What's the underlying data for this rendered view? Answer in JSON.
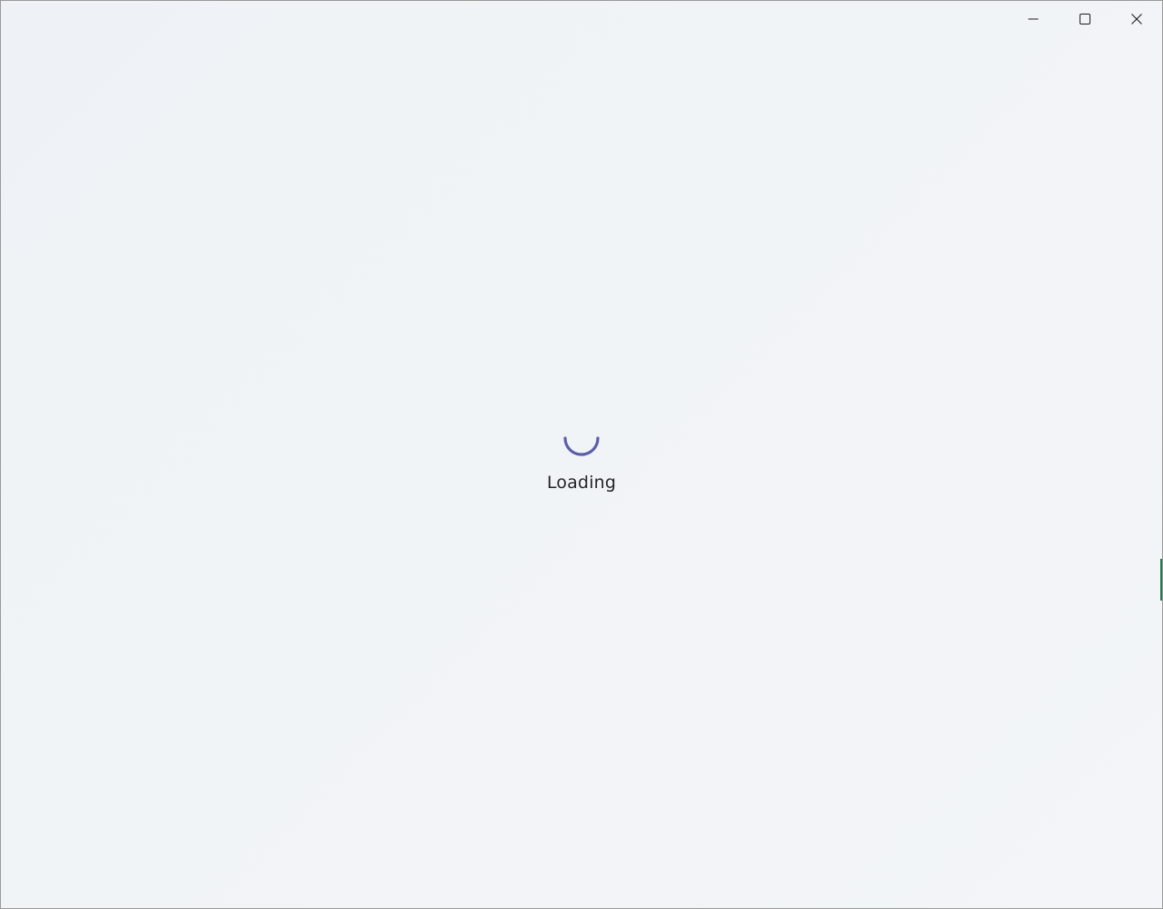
{
  "window": {
    "controls": {
      "minimize": "minimize-icon",
      "maximize": "maximize-icon",
      "close": "close-icon"
    }
  },
  "main": {
    "loading_label": "Loading",
    "spinner_icon": "loading-spinner-icon",
    "accent_color": "#5b5fa8"
  }
}
